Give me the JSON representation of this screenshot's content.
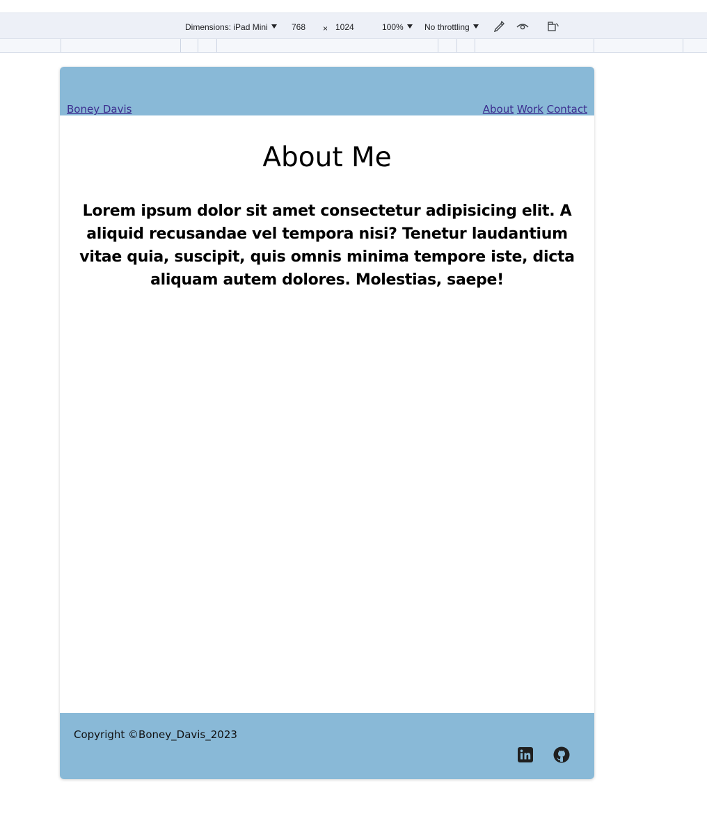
{
  "devtools": {
    "dimensions_label": "Dimensions: iPad Mini",
    "width_value": "768",
    "times_symbol": "×",
    "height_value": "1024",
    "zoom": "100%",
    "throttling": "No throttling",
    "icons": [
      "eyedropper-icon",
      "eye-icon",
      "rotate-device-icon"
    ]
  },
  "site": {
    "brand": "Boney Davis",
    "nav": {
      "about": "About",
      "work": "Work",
      "contact": "Contact"
    },
    "title": "About Me",
    "intro": "Lorem ipsum dolor sit amet consectetur adipisicing elit. A aliquid recusandae vel tempora nisi? Tenetur laudantium vitae quia, suscipit, quis omnis minima tempore iste, dicta aliquam autem dolores. Molestias, saepe!",
    "footer": {
      "copyright": "Copyright ©Boney_Davis_2023",
      "social_icons": [
        "linkedin-icon",
        "github-icon"
      ]
    },
    "colors": {
      "header_footer_bg": "#89b9d7",
      "link": "#3c2e8f",
      "devtools_bg": "#edf0f7"
    }
  }
}
